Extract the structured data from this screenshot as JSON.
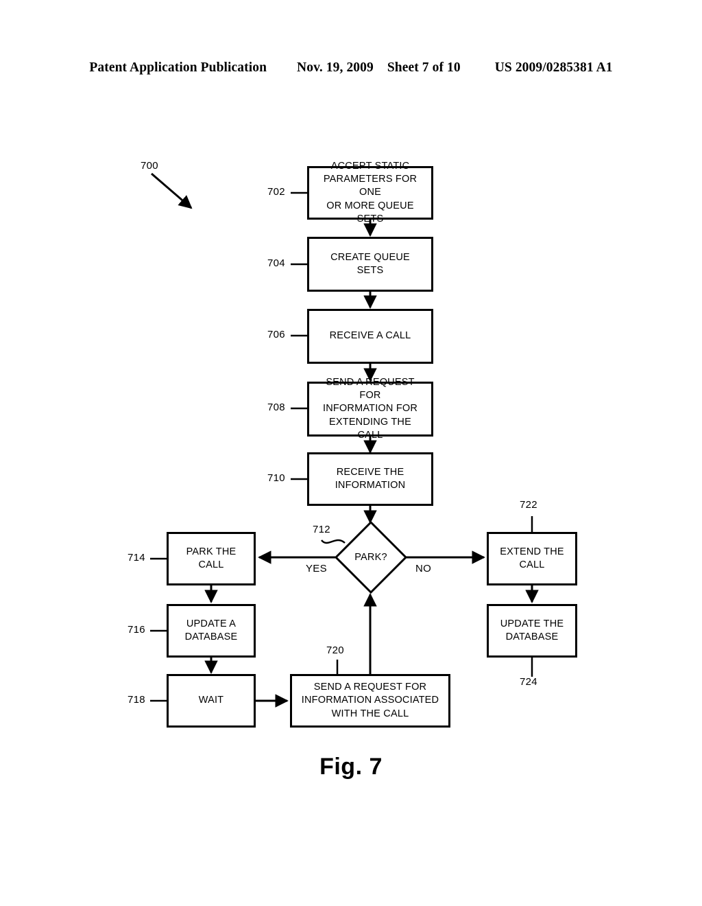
{
  "header": {
    "publication": "Patent Application Publication",
    "date": "Nov. 19, 2009",
    "sheet": "Sheet 7 of 10",
    "patent_number": "US 2009/0285381 A1"
  },
  "figure": {
    "caption": "Fig. 7",
    "diagram_ref": "700"
  },
  "flowchart": {
    "type": "flowchart",
    "nodes": [
      {
        "ref": "702",
        "shape": "process",
        "text": "ACCEPT STATIC PARAMETERS FOR ONE OR MORE QUEUE SETS"
      },
      {
        "ref": "704",
        "shape": "process",
        "text": "CREATE QUEUE SETS"
      },
      {
        "ref": "706",
        "shape": "process",
        "text": "RECEIVE A CALL"
      },
      {
        "ref": "708",
        "shape": "process",
        "text": "SEND A REQUEST FOR INFORMATION FOR EXTENDING THE CALL"
      },
      {
        "ref": "710",
        "shape": "process",
        "text": "RECEIVE THE INFORMATION"
      },
      {
        "ref": "712",
        "shape": "decision",
        "text": "PARK?"
      },
      {
        "ref": "714",
        "shape": "process",
        "text": "PARK THE CALL"
      },
      {
        "ref": "716",
        "shape": "process",
        "text": "UPDATE A DATABASE"
      },
      {
        "ref": "718",
        "shape": "process",
        "text": "WAIT"
      },
      {
        "ref": "720",
        "shape": "process",
        "text": "SEND A REQUEST FOR INFORMATION ASSOCIATED WITH THE CALL"
      },
      {
        "ref": "722",
        "shape": "process",
        "text": "EXTEND THE CALL"
      },
      {
        "ref": "724",
        "shape": "process",
        "text": "UPDATE THE DATABASE"
      }
    ],
    "edge_labels": {
      "yes": "YES",
      "no": "NO"
    },
    "box_702": {
      "line1": "ACCEPT STATIC",
      "line2": "PARAMETERS FOR ONE",
      "line3": "OR MORE QUEUE SETS"
    },
    "box_704": {
      "line1": "CREATE QUEUE SETS"
    },
    "box_706": {
      "line1": "RECEIVE A CALL"
    },
    "box_708": {
      "line1": "SEND A REQUEST FOR",
      "line2": "INFORMATION FOR",
      "line3": "EXTENDING THE CALL"
    },
    "box_710": {
      "line1": "RECEIVE THE",
      "line2": "INFORMATION"
    },
    "diamond_712": {
      "line1": "PARK?"
    },
    "box_714": {
      "line1": "PARK THE",
      "line2": "CALL"
    },
    "box_716": {
      "line1": "UPDATE A",
      "line2": "DATABASE"
    },
    "box_718": {
      "line1": "WAIT"
    },
    "box_720": {
      "line1": "SEND A REQUEST FOR",
      "line2": "INFORMATION ASSOCIATED",
      "line3": "WITH THE CALL"
    },
    "box_722": {
      "line1": "EXTEND THE",
      "line2": "CALL"
    },
    "box_724": {
      "line1": "UPDATE THE",
      "line2": "DATABASE"
    },
    "refs": {
      "r700": "700",
      "r702": "702",
      "r704": "704",
      "r706": "706",
      "r708": "708",
      "r710": "710",
      "r712": "712",
      "r714": "714",
      "r716": "716",
      "r718": "718",
      "r720": "720",
      "r722": "722",
      "r724": "724"
    }
  },
  "colors": {
    "ink": "#000000",
    "paper": "#ffffff"
  }
}
